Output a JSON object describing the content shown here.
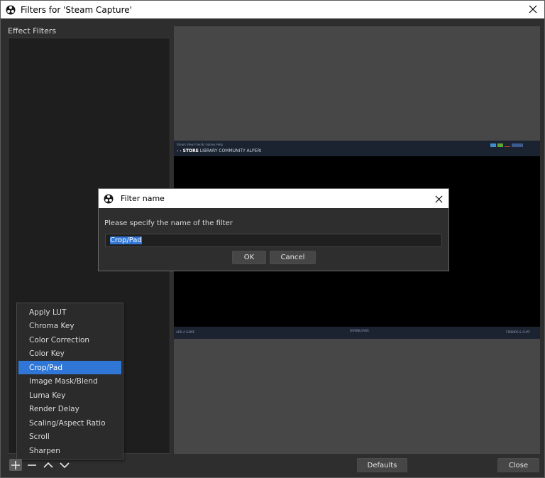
{
  "window": {
    "title": "Filters for 'Steam Capture'"
  },
  "left_panel": {
    "label": "Effect Filters"
  },
  "steam_preview": {
    "menu": "Steam  View  Friends  Games  Help",
    "nav_store": "STORE",
    "nav_rest": "LIBRARY   COMMUNITY   ALPERI",
    "footer_left": "ADD A GAME",
    "footer_center": "DOWNLOADS",
    "footer_right": "FRIENDS & CHAT"
  },
  "dialog": {
    "title": "Filter name",
    "prompt": "Please specify the name of the filter",
    "input_value": "Crop/Pad",
    "ok_label": "OK",
    "cancel_label": "Cancel"
  },
  "context_menu": {
    "items": [
      {
        "label": "Apply LUT"
      },
      {
        "label": "Chroma Key"
      },
      {
        "label": "Color Correction"
      },
      {
        "label": "Color Key"
      },
      {
        "label": "Crop/Pad"
      },
      {
        "label": "Image Mask/Blend"
      },
      {
        "label": "Luma Key"
      },
      {
        "label": "Render Delay"
      },
      {
        "label": "Scaling/Aspect Ratio"
      },
      {
        "label": "Scroll"
      },
      {
        "label": "Sharpen"
      }
    ],
    "selected_index": 4
  },
  "footer": {
    "defaults_label": "Defaults",
    "close_label": "Close"
  },
  "icons": {
    "app": "obs-logo-icon",
    "close": "close-icon",
    "add": "plus-icon",
    "remove": "minus-icon",
    "up": "chevron-up-icon",
    "down": "chevron-down-icon"
  },
  "colors": {
    "accent": "#2f76d6",
    "background": "#2e2e2e",
    "list_background": "#1e1e1e",
    "preview_background": "#474747"
  }
}
